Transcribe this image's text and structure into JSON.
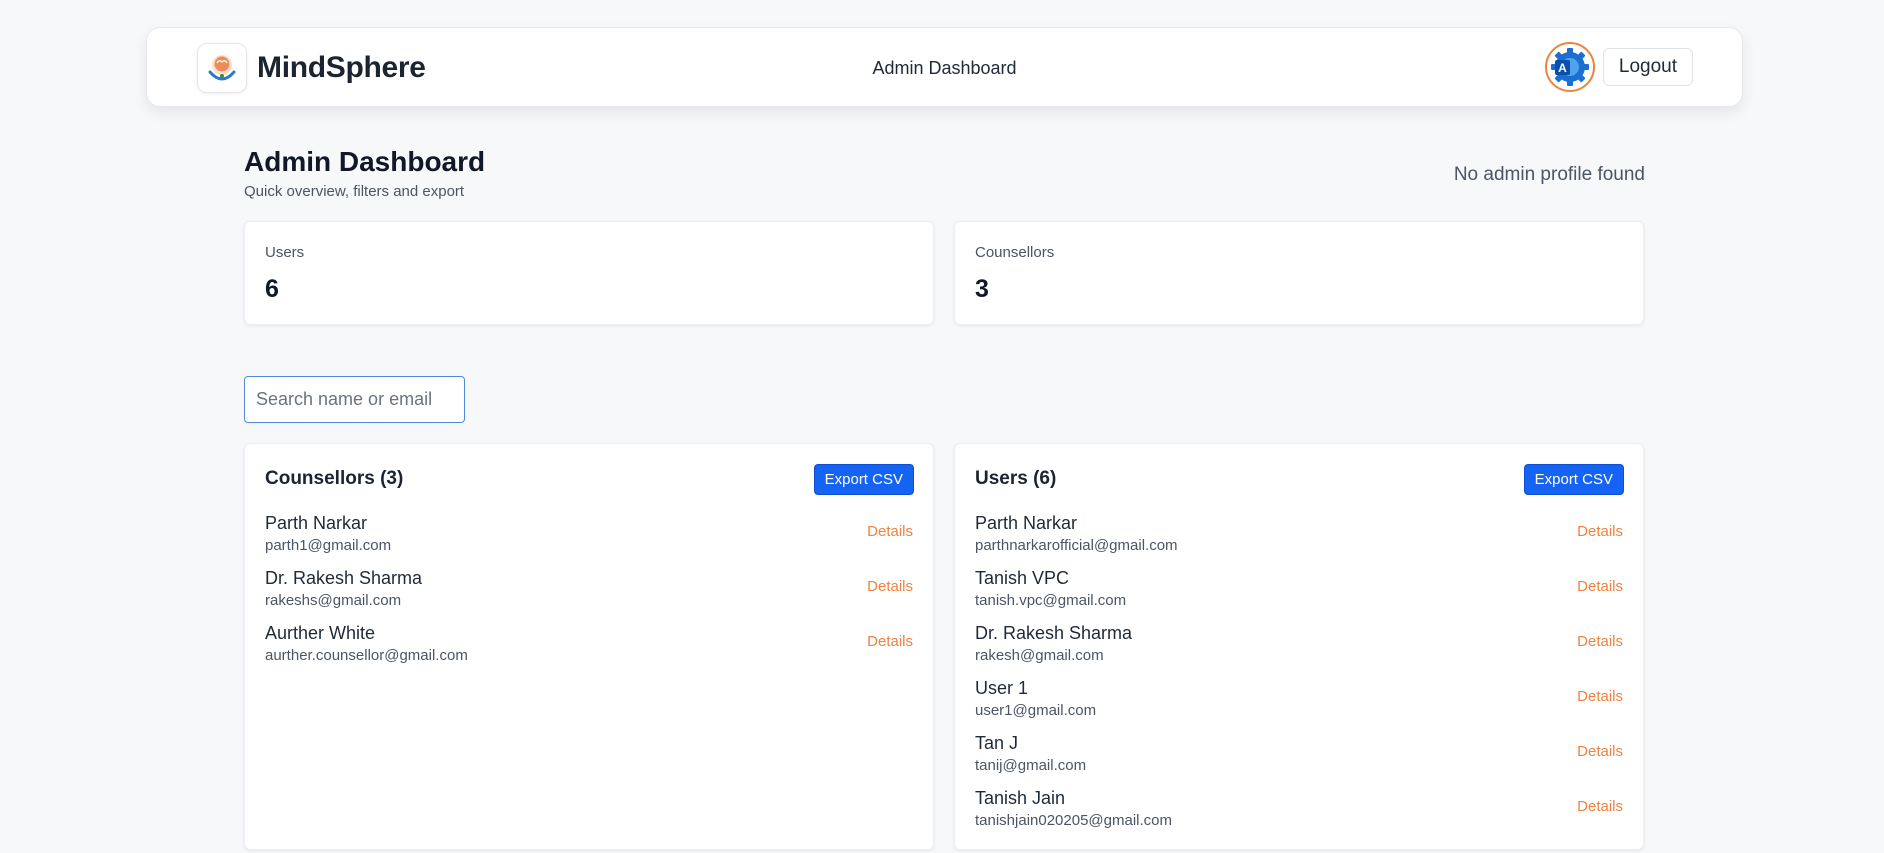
{
  "header": {
    "brand": "MindSphere",
    "center_title": "Admin Dashboard",
    "logout_label": "Logout",
    "avatar_icon": "admin-gear-avatar-icon"
  },
  "page": {
    "title": "Admin Dashboard",
    "subtitle": "Quick overview, filters and export",
    "profile_note": "No admin profile found"
  },
  "stats": {
    "users": {
      "label": "Users",
      "value": "6"
    },
    "counsellors": {
      "label": "Counsellors",
      "value": "3"
    }
  },
  "search": {
    "placeholder": "Search name or email"
  },
  "counsellors": {
    "title": "Counsellors (3)",
    "export_label": "Export CSV",
    "items": [
      {
        "name": "Parth Narkar",
        "email": "parth1@gmail.com",
        "action": "Details"
      },
      {
        "name": "Dr. Rakesh Sharma",
        "email": "rakeshs@gmail.com",
        "action": "Details"
      },
      {
        "name": "Aurther White",
        "email": "aurther.counsellor@gmail.com",
        "action": "Details"
      }
    ]
  },
  "users": {
    "title": "Users (6)",
    "export_label": "Export CSV",
    "items": [
      {
        "name": "Parth Narkar",
        "email": "parthnarkarofficial@gmail.com",
        "action": "Details"
      },
      {
        "name": "Tanish VPC",
        "email": "tanish.vpc@gmail.com",
        "action": "Details"
      },
      {
        "name": "Dr. Rakesh Sharma",
        "email": "rakesh@gmail.com",
        "action": "Details"
      },
      {
        "name": "User 1",
        "email": "user1@gmail.com",
        "action": "Details"
      },
      {
        "name": "Tan J",
        "email": "tanij@gmail.com",
        "action": "Details"
      },
      {
        "name": "Tanish Jain",
        "email": "tanishjain020205@gmail.com",
        "action": "Details"
      }
    ]
  },
  "colors": {
    "accent": "#f0823f",
    "primary_button": "#1463f3",
    "page_background": "#f7f8fa"
  }
}
